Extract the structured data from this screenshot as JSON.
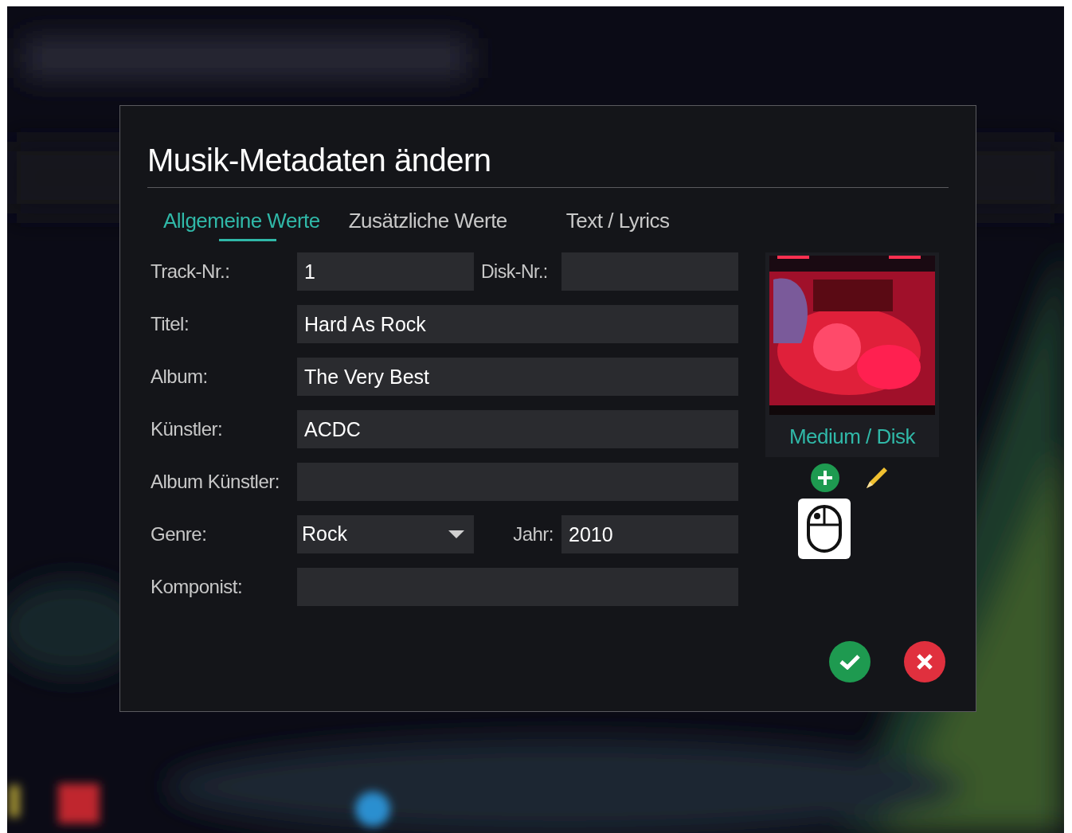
{
  "dialog": {
    "title": "Musik-Metadaten ändern",
    "tabs": [
      {
        "label": "Allgemeine Werte",
        "selected": true
      },
      {
        "label": "Zusätzliche Werte",
        "selected": false
      },
      {
        "label": "Text / Lyrics",
        "selected": false
      }
    ],
    "fields": {
      "track": {
        "label": "Track-Nr.:",
        "value": "1"
      },
      "disk": {
        "label": "Disk-Nr.:"
      },
      "title": {
        "label": "Titel:",
        "value": "Hard As Rock"
      },
      "album": {
        "label": "Album:",
        "value": "The Very Best"
      },
      "artist": {
        "label": "Künstler:",
        "value": "ACDC"
      },
      "album_artist": {
        "label": "Album Künstler:"
      },
      "genre": {
        "label": "Genre:",
        "value": "Rock"
      },
      "year": {
        "label": "Jahr:",
        "value": "2010"
      },
      "composer": {
        "label": "Komponist:"
      }
    },
    "cover": {
      "kind": "picture",
      "caption": "Medium / Disk"
    }
  }
}
